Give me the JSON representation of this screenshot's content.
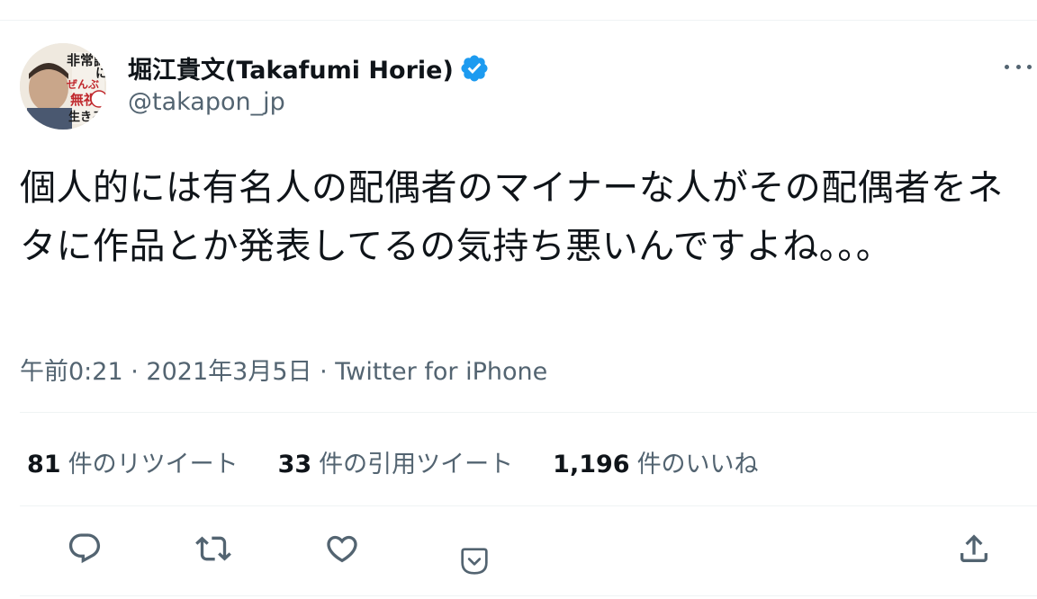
{
  "author": {
    "display_name": "堀江貴文(Takafumi Horie)",
    "handle": "@takapon_jp",
    "verified": true,
    "avatar_text": [
      "非常識",
      "に",
      "ぜんぶ",
      "無視",
      "生きる"
    ]
  },
  "tweet": {
    "text": "個人的には有名人の配偶者のマイナーな人がその配偶者をネタに作品とか発表してるの気持ち悪いんですよね。。。",
    "time": "午前0:21",
    "separator": "·",
    "date": "2021年3月5日",
    "source": "Twitter for iPhone"
  },
  "stats": {
    "retweets": {
      "count": "81",
      "label": "件のリツイート"
    },
    "quotes": {
      "count": "33",
      "label": "件の引用ツイート"
    },
    "likes": {
      "count": "1,196",
      "label": "件のいいね"
    }
  },
  "icons": {
    "more": "more-dots-icon",
    "reply": "reply-icon",
    "retweet": "retweet-icon",
    "like": "heart-icon",
    "dislike": "downvote-icon",
    "share": "share-icon",
    "verified": "verified-badge-icon"
  },
  "colors": {
    "text": "#0f1419",
    "secondary": "#536471",
    "verified": "#1d9bf0",
    "divider": "#eff3f4"
  }
}
